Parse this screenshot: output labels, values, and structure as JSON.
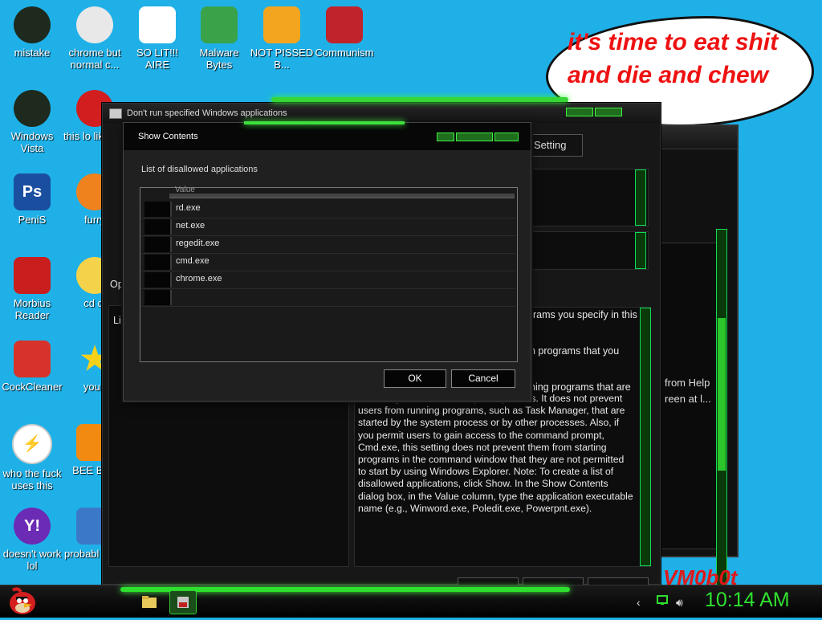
{
  "desktop": {
    "icons": [
      {
        "label": "mistake",
        "icon": "green-orb-icon",
        "color": "#1d2a1d"
      },
      {
        "label": "chrome but normal c...",
        "icon": "chrome-icon",
        "color": "#e8e8e8"
      },
      {
        "label": "SO LIT!!! AIRE",
        "icon": "solitaire-cards-icon",
        "color": "#ffffff"
      },
      {
        "label": "Malware Bytes",
        "icon": "shield-check-icon",
        "color": "#3aa34a"
      },
      {
        "label": "NOT PISSED B...",
        "icon": "green-pig-icon",
        "color": "#f3a51f"
      },
      {
        "label": "Communism",
        "icon": "hammer-flag-icon",
        "color": "#c0242a"
      },
      {
        "label": "Windows Vista",
        "icon": "recycle-bin-icon",
        "color": "#1d2a1d"
      },
      {
        "label": "this lo like a v",
        "icon": "opera-icon",
        "color": "#d21e1e"
      },
      {
        "label": "PeniS",
        "icon": "photoshop-icon",
        "color": "#1a4fa0"
      },
      {
        "label": "furry",
        "icon": "firefox-icon",
        "color": "#f0821e"
      },
      {
        "label": "Morbius Reader",
        "icon": "pdf-reader-icon",
        "color": "#c81e1e"
      },
      {
        "label": "cd di",
        "icon": "disc-icon",
        "color": "#f4d34a"
      },
      {
        "label": "CockCleaner",
        "icon": "ccleaner-icon",
        "color": "#d7332a"
      },
      {
        "label": "you t",
        "icon": "star-icon",
        "color": "#f6d11a"
      },
      {
        "label": "who the fuck uses this",
        "icon": "lightning-icon",
        "color": "#ffffff"
      },
      {
        "label": "BEE BEE",
        "icon": "vlc-cone-icon",
        "color": "#f28a12"
      },
      {
        "label": "doesn't work lol",
        "icon": "yahoo-messenger-icon",
        "color": "#6b2bb5"
      },
      {
        "label": "probabl a roc",
        "icon": "computer-icon",
        "color": "#3c78c8"
      }
    ]
  },
  "bubble": {
    "text": "it's time to eat shit and die and chew gum"
  },
  "policy_window": {
    "title": "Don't run specified Windows applications",
    "setting_button": "Setting",
    "options_label": "Op",
    "list_label_partial": "Lis",
    "help_fragments": [
      "rams you specify in this",
      "n programs that you",
      "ning programs that are"
    ],
    "help_text": "started by the Windows Explorer process. It does not prevent users from running programs, such as Task Manager, that are started by the system process or by other processes. Also, if you permit users to gain access to the command prompt, Cmd.exe, this setting does not prevent them from starting programs in the command window that they are not permitted to start by using Windows Explorer. Note: To create a list of disallowed applications, click Show. In the Show Contents dialog box, in the Value column, type the application executable name (e.g., Winword.exe, Poledit.exe, Powerpnt.exe)."
  },
  "back_window": {
    "text": "from Help\nreen at l..."
  },
  "dialog": {
    "title": "Show Contents",
    "list_label": "List of disallowed applications",
    "column_header": "Value",
    "values": [
      "rd.exe",
      "net.exe",
      "regedit.exe",
      "cmd.exe",
      "chrome.exe",
      ""
    ],
    "ok_label": "OK",
    "cancel_label": "Cancel"
  },
  "taskbar": {
    "clock": "10:14 AM",
    "accent": "#2fe12f"
  },
  "watermark": "VM0b0t"
}
